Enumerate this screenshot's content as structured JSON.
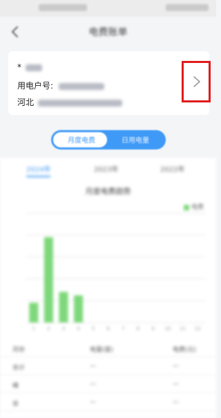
{
  "header": {
    "title": "电费账单"
  },
  "user_card": {
    "name_prefix": "*",
    "account_label": "用电户号:",
    "address_prefix": "河北"
  },
  "toggle": {
    "monthly_label": "月度电费",
    "daily_label": "日用电量"
  },
  "content": {
    "year_tabs": [
      "2024年",
      "2023年",
      "2022年"
    ],
    "chart_title": "月度电费趋势",
    "legend_label": "电费"
  },
  "chart_data": {
    "type": "bar",
    "categories": [
      "1",
      "2",
      "3",
      "4",
      "5",
      "6",
      "7",
      "8",
      "9",
      "10",
      "11",
      "12"
    ],
    "values": [
      45,
      195,
      70,
      62,
      0,
      0,
      0,
      0,
      0,
      0,
      0,
      0
    ],
    "ylim": [
      0,
      250
    ],
    "grid": true,
    "legend": "top-right",
    "colors": {
      "bar": "#7dd87a"
    }
  },
  "table": {
    "rows": [
      [
        "月份",
        "电量(度)",
        "电费(元)"
      ],
      [
        "合计",
        "—",
        "—"
      ],
      [
        "峰",
        "—",
        "—"
      ],
      [
        "谷",
        "—",
        "—"
      ]
    ]
  },
  "colors": {
    "accent": "#3f9af7",
    "highlight_box": "#e01b1b"
  },
  "icons": {
    "back": "chevron-left-icon",
    "detail": "chevron-right-icon"
  }
}
